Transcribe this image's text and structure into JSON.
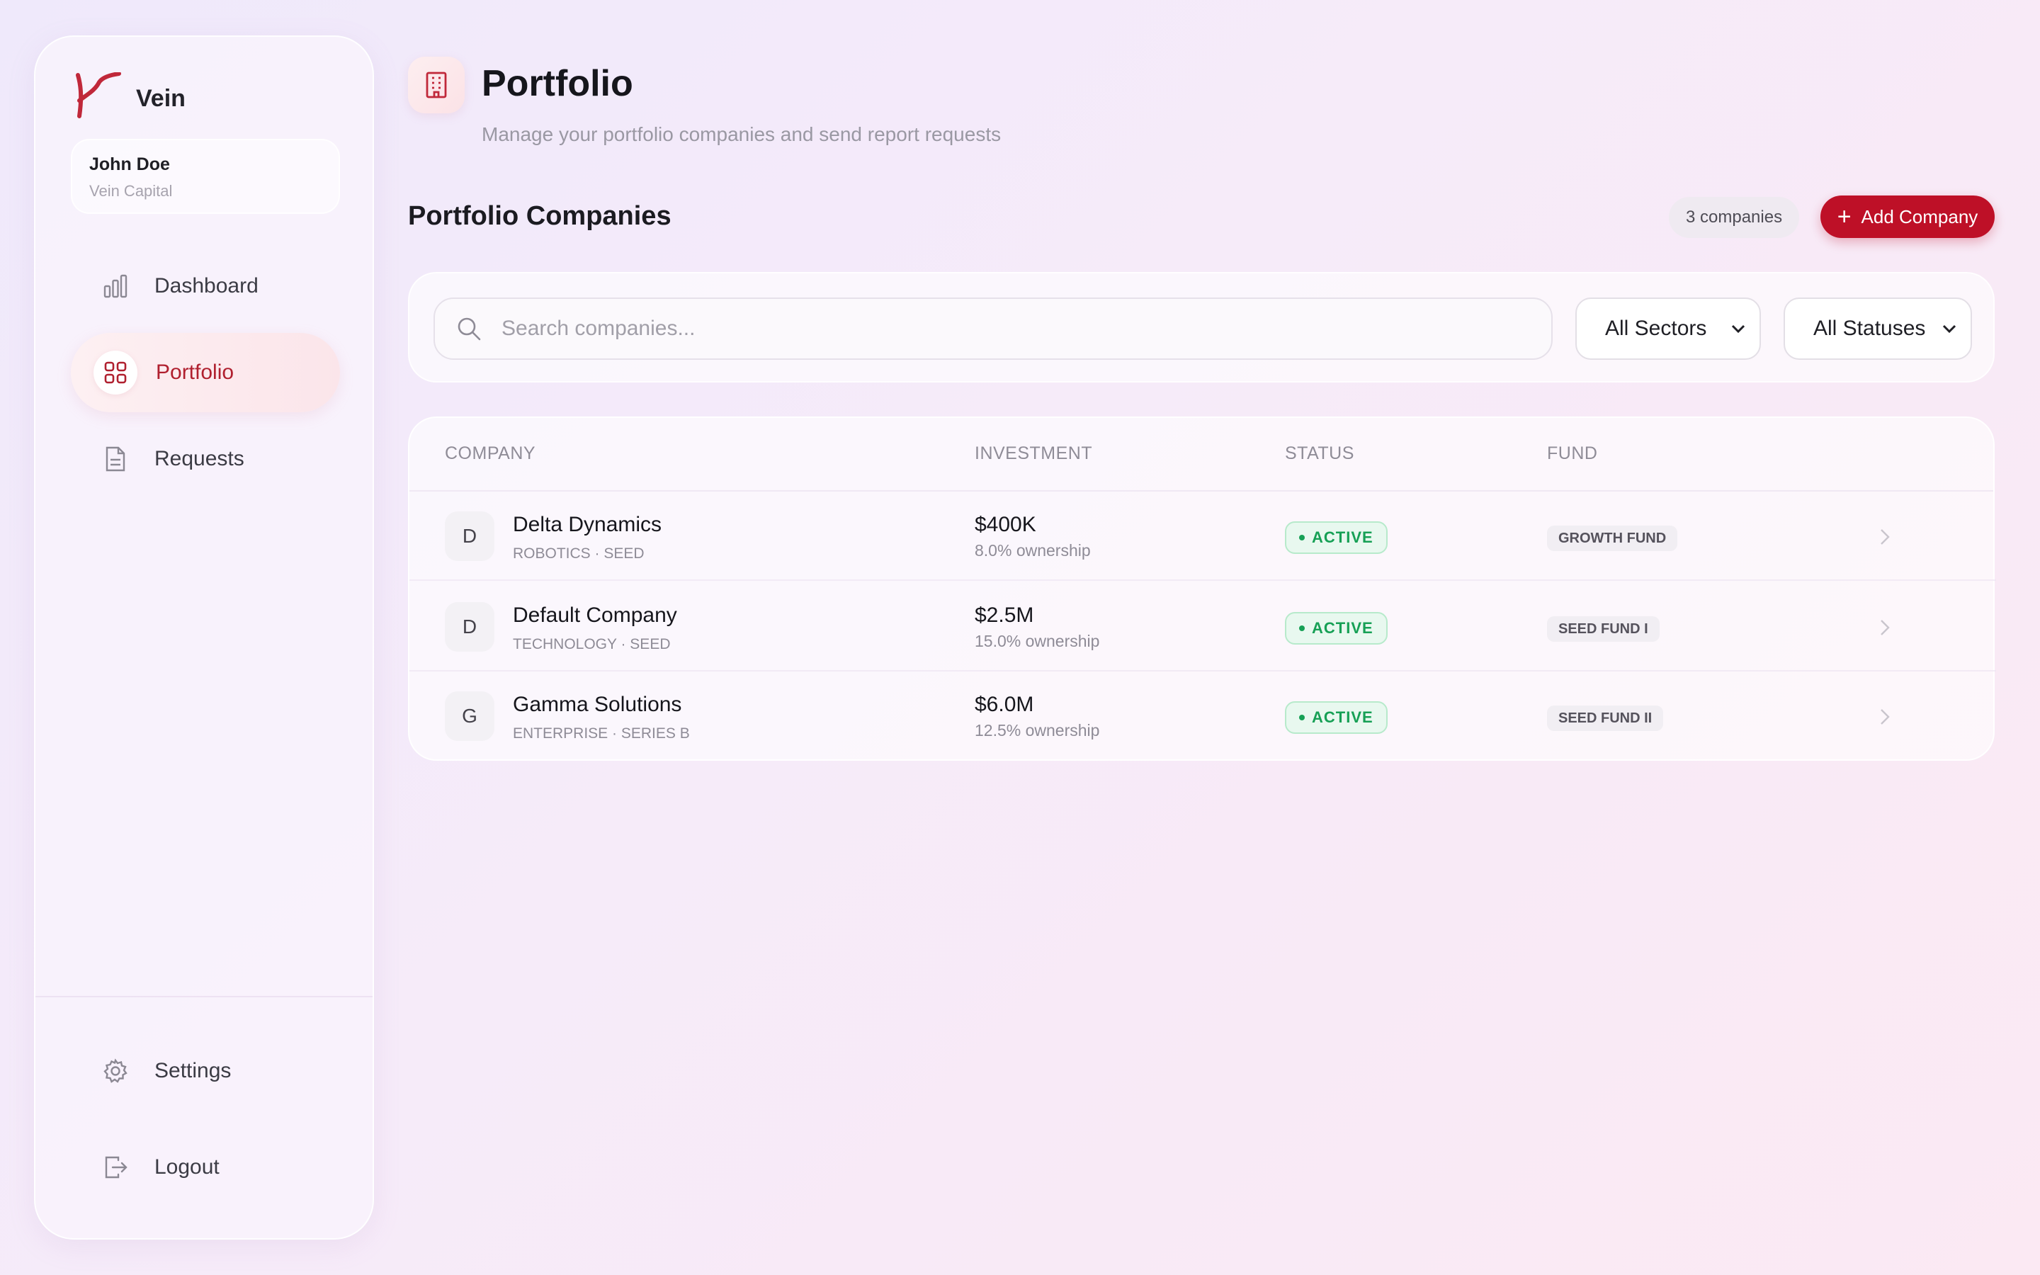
{
  "brand": {
    "name": "Vein",
    "color": "#c0283a"
  },
  "user": {
    "name": "John Doe",
    "org": "Vein Capital"
  },
  "nav": {
    "items": [
      {
        "label": "Dashboard",
        "icon": "bar-chart-icon",
        "active": false
      },
      {
        "label": "Portfolio",
        "icon": "grid-icon",
        "active": true
      },
      {
        "label": "Requests",
        "icon": "document-icon",
        "active": false
      }
    ],
    "bottom": [
      {
        "label": "Settings",
        "icon": "gear-icon"
      },
      {
        "label": "Logout",
        "icon": "logout-icon"
      }
    ]
  },
  "header": {
    "title": "Portfolio",
    "subtitle": "Manage your portfolio companies and send report requests",
    "icon": "building-icon"
  },
  "section": {
    "title": "Portfolio Companies",
    "count": "3 companies",
    "add_label": "Add Company"
  },
  "filters": {
    "search_placeholder": "Search companies...",
    "sector": "All Sectors",
    "status": "All Statuses"
  },
  "table": {
    "columns": [
      "COMPANY",
      "INVESTMENT",
      "STATUS",
      "FUND"
    ],
    "rows": [
      {
        "initial": "D",
        "name": "Delta Dynamics",
        "meta": "ROBOTICS · SEED",
        "amount": "$400K",
        "ownership": "8.0% ownership",
        "status": "ACTIVE",
        "fund": "GROWTH FUND"
      },
      {
        "initial": "D",
        "name": "Default Company",
        "meta": "TECHNOLOGY · SEED",
        "amount": "$2.5M",
        "ownership": "15.0% ownership",
        "status": "ACTIVE",
        "fund": "SEED FUND I"
      },
      {
        "initial": "G",
        "name": "Gamma Solutions",
        "meta": "ENTERPRISE · SERIES B",
        "amount": "$6.0M",
        "ownership": "12.5% ownership",
        "status": "ACTIVE",
        "fund": "SEED FUND II"
      }
    ]
  },
  "colors": {
    "accent": "#be1027",
    "active_status": "#16a055"
  }
}
